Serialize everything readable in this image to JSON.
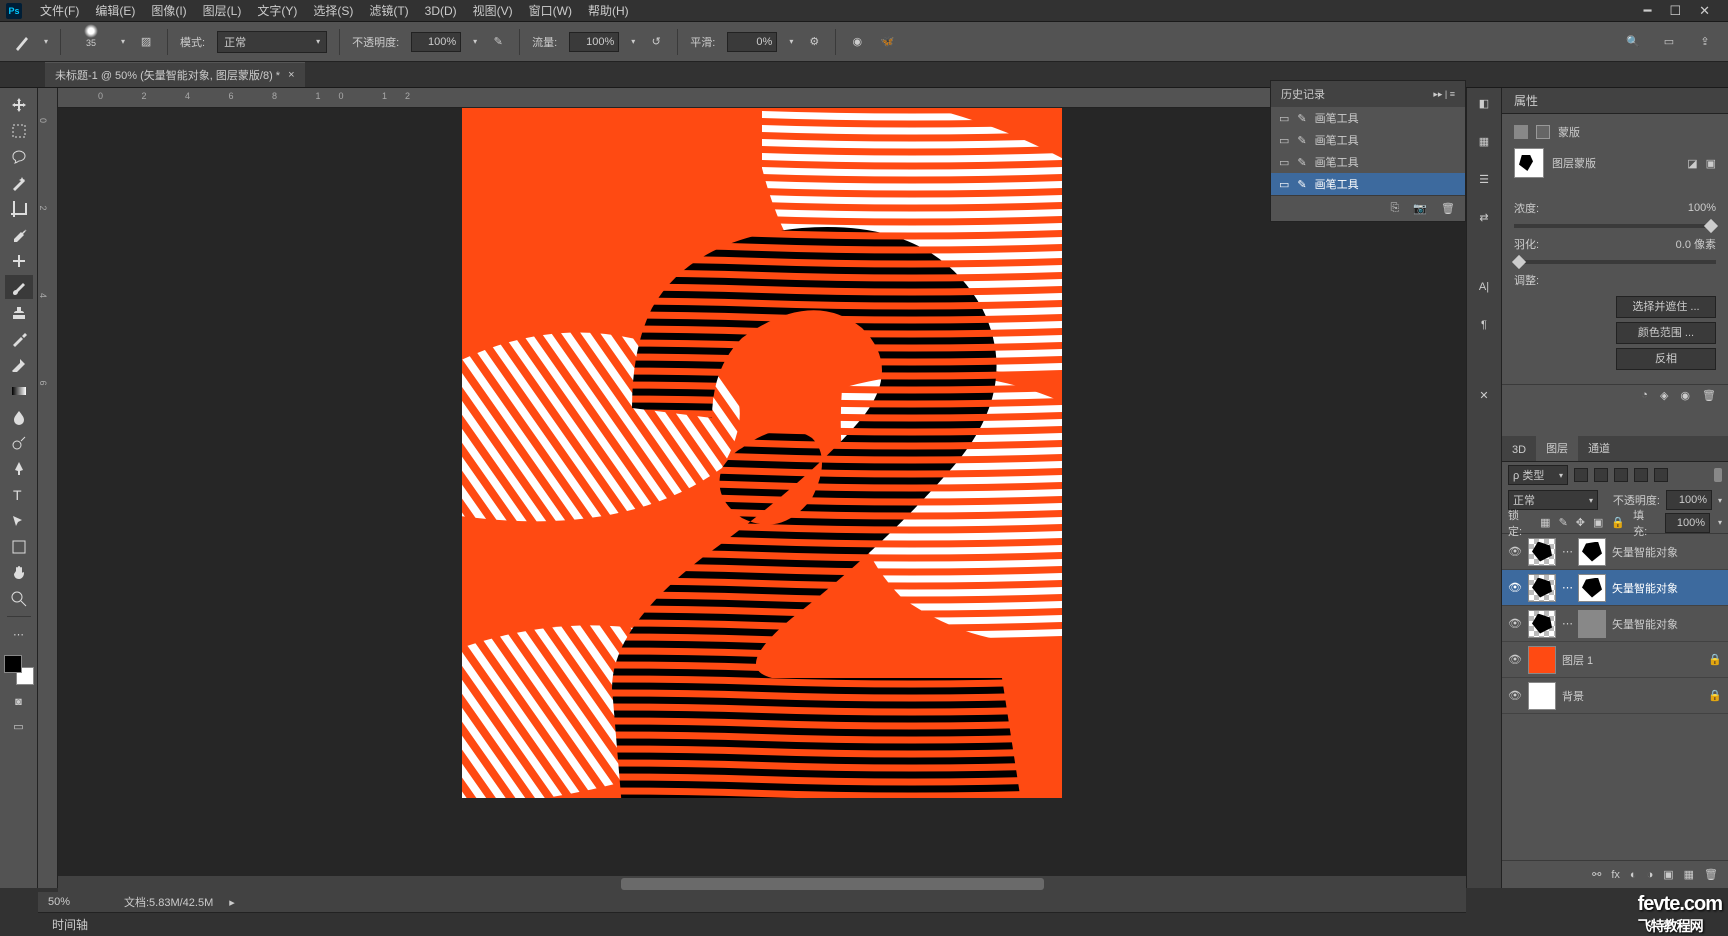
{
  "menu": {
    "items": [
      "文件(F)",
      "编辑(E)",
      "图像(I)",
      "图层(L)",
      "文字(Y)",
      "选择(S)",
      "滤镜(T)",
      "3D(D)",
      "视图(V)",
      "窗口(W)",
      "帮助(H)"
    ]
  },
  "options": {
    "brush_size": "35",
    "mode_label": "模式:",
    "mode_value": "正常",
    "opacity_label": "不透明度:",
    "opacity_value": "100%",
    "flow_label": "流量:",
    "flow_value": "100%",
    "smooth_label": "平滑:",
    "smooth_value": "0%"
  },
  "doctab": {
    "title": "未标题-1 @ 50% (矢量智能对象, 图层蒙版/8) *"
  },
  "history": {
    "title": "历史记录",
    "rows": [
      "画笔工具",
      "画笔工具",
      "画笔工具",
      "画笔工具"
    ]
  },
  "properties": {
    "title": "属性",
    "subtitle": "蒙版",
    "mask_label": "图层蒙版",
    "density_label": "浓度:",
    "density_value": "100%",
    "feather_label": "羽化:",
    "feather_value": "0.0 像素",
    "adjust_label": "调整:",
    "btn_select": "选择并遮住 ...",
    "btn_colorrange": "颜色范围 ...",
    "btn_invert": "反相"
  },
  "layers_tabs": {
    "t3d": "3D",
    "layers": "图层",
    "channels": "通道"
  },
  "layers": {
    "filter_label": "类型",
    "blend_label": "正常",
    "opacity_label": "不透明度:",
    "opacity_value": "100%",
    "lock_label": "锁定:",
    "fill_label": "填充:",
    "fill_value": "100%",
    "rows": [
      {
        "name": "矢量智能对象",
        "selected": false,
        "mask": true
      },
      {
        "name": "矢量智能对象",
        "selected": true,
        "mask": true
      },
      {
        "name": "矢量智能对象",
        "selected": false,
        "mask": true
      },
      {
        "name": "图层 1",
        "selected": false,
        "solid": true,
        "locked": true
      },
      {
        "name": "背景",
        "selected": false,
        "white": true,
        "locked": true
      }
    ]
  },
  "status": {
    "zoom": "50%",
    "docinfo": "文档:5.83M/42.5M"
  },
  "timeline": {
    "label": "时间轴"
  },
  "filter_type_prefix": "ρ",
  "watermark": {
    "main": "fevte.com",
    "cn": "飞特教程网"
  }
}
